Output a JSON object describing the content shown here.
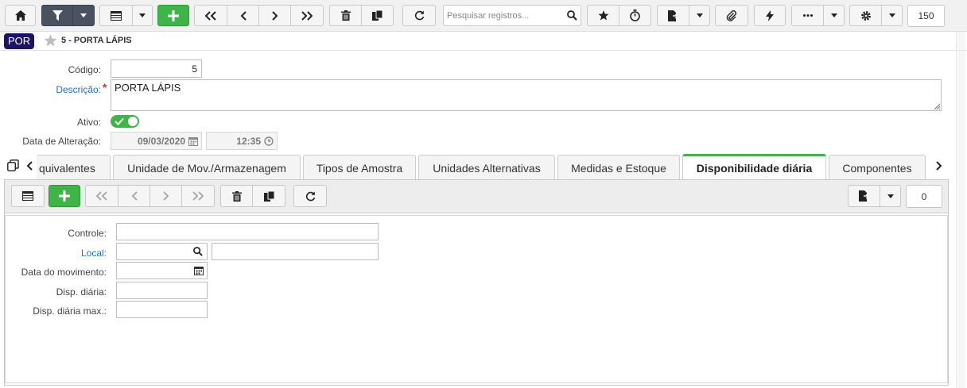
{
  "toolbar": {
    "search_placeholder": "Pesquisar registros...",
    "record_count": "150"
  },
  "record": {
    "badge": "POR",
    "title": "5 - PORTA LÁPIS"
  },
  "form": {
    "codigo_label": "Código:",
    "codigo_value": "5",
    "descricao_label": "Descrição:",
    "descricao_required": "*",
    "descricao_value": "PORTA LÁPIS",
    "ativo_label": "Ativo:",
    "data_alteracao_label": "Data de Alteração:",
    "data_alteracao_date": "09/03/2020",
    "data_alteracao_time": "12:35"
  },
  "tabs": [
    {
      "label": "quivalentes"
    },
    {
      "label": "Unidade de Mov./Armazenagem"
    },
    {
      "label": "Tipos de Amostra"
    },
    {
      "label": "Unidades Alternativas"
    },
    {
      "label": "Medidas e Estoque"
    },
    {
      "label": "Disponibilidade diária"
    },
    {
      "label": "Componentes"
    }
  ],
  "subtoolbar": {
    "record_count": "0"
  },
  "detail": {
    "controle_label": "Controle:",
    "local_label": "Local:",
    "data_movimento_label": "Data do movimento:",
    "disp_diaria_label": "Disp. diária:",
    "disp_diaria_max_label": "Disp. diária max.:"
  },
  "colors": {
    "accent_green": "#3fb449",
    "badge_navy": "#1b1464",
    "link_blue": "#1a6fc9",
    "toolbar_dark": "#4a5261"
  }
}
